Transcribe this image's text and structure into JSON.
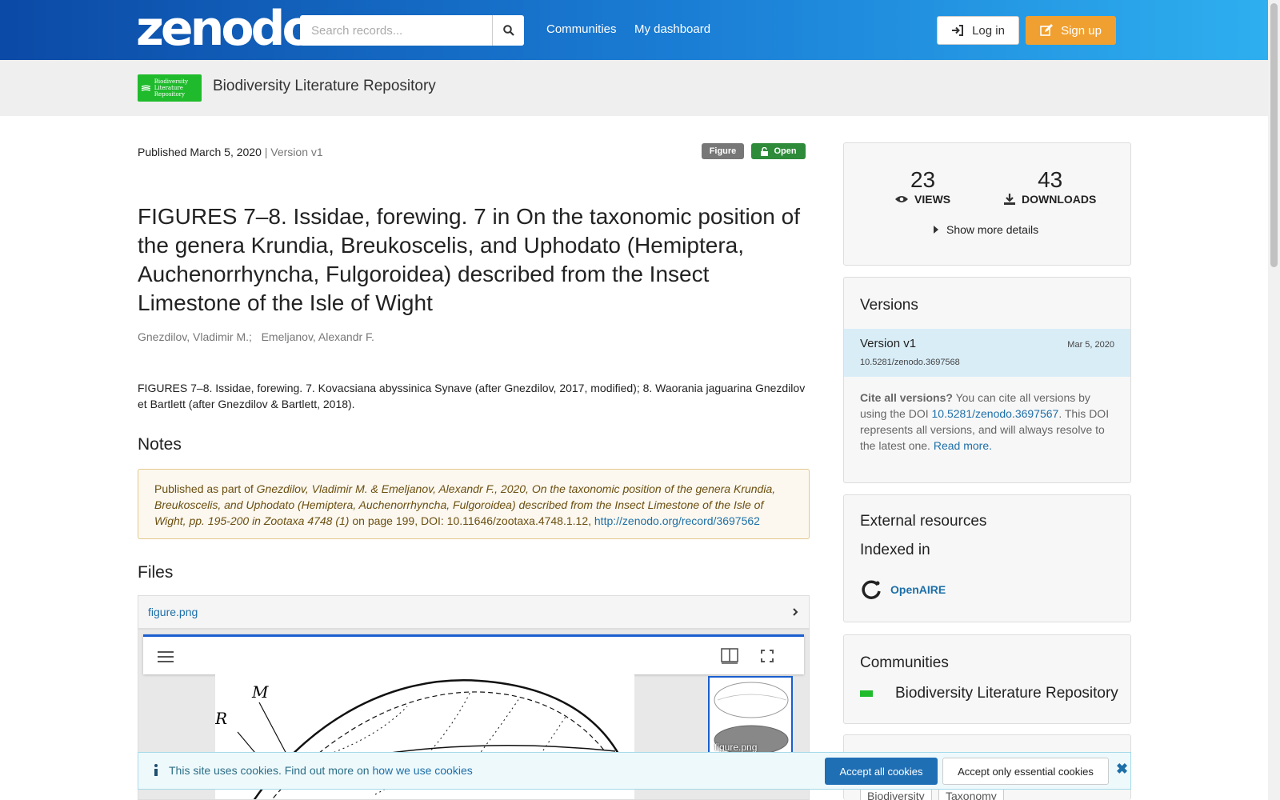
{
  "header": {
    "logo": "zenodo",
    "search_placeholder": "Search records...",
    "nav": [
      "Communities",
      "My dashboard"
    ],
    "login_label": "Log in",
    "signup_label": "Sign up",
    "accent_color": "#f0a030"
  },
  "community_bar": {
    "logo_text": "Biodiversity Literature Repository",
    "title": "Biodiversity Literature Repository"
  },
  "record": {
    "published": "Published March 5, 2020",
    "version": "| Version v1",
    "badge_type": "Figure",
    "badge_access": "Open",
    "title": "FIGURES 7–8. Issidae, forewing. 7 in On the taxonomic position of the genera Krundia, Breukoscelis, and Uphodato (Hemiptera, Auchenorrhyncha, Fulgoroidea) described from the Insect Limestone of the Isle of Wight",
    "authors": [
      "Gnezdilov, Vladimir M.;",
      "Emeljanov, Alexandr F."
    ],
    "description": "FIGURES 7–8. Issidae, forewing. 7. Kovacsiana abyssinica Synave (after Gnezdilov, 2017, modified); 8. Waorania jaguarina Gnezdilov et Bartlett (after Gnezdilov & Bartlett, 2018)."
  },
  "notes": {
    "heading": "Notes",
    "prefix": "Published as part of ",
    "citation": "Gnezdilov, Vladimir M. & Emeljanov, Alexandr F., 2020, On the taxonomic position of the genera Krundia, Breukoscelis, and Uphodato (Hemiptera, Auchenorrhyncha, Fulgoroidea) described from the Insect Limestone of the Isle of Wight, pp. 195-200 in Zootaxa 4748 (1)",
    "suffix": " on page 199, DOI: 10.11646/zootaxa.4748.1.12, ",
    "link": "http://zenodo.org/record/3697562"
  },
  "files": {
    "heading": "Files",
    "filename": "figure.png",
    "thumb_label": "figure.png",
    "figure_labels": [
      "M",
      "R"
    ]
  },
  "stats": {
    "views_count": "23",
    "views_label": "VIEWS",
    "downloads_count": "43",
    "downloads_label": "DOWNLOADS",
    "more_details": "Show more details"
  },
  "versions": {
    "heading": "Versions",
    "items": [
      {
        "name": "Version v1",
        "date": "Mar 5, 2020",
        "doi": "10.5281/zenodo.3697568"
      }
    ],
    "cite_strong": "Cite all versions?",
    "cite_text1": " You can cite all versions by using the DOI ",
    "cite_doi": "10.5281/zenodo.3697567",
    "cite_text2": ". This DOI represents all versions, and will always resolve to the latest one. ",
    "read_more": "Read more."
  },
  "external": {
    "heading": "External resources",
    "subheading": "Indexed in",
    "openaire": "OpenAIRE"
  },
  "communities": {
    "heading": "Communities",
    "item": "Biodiversity Literature Repository"
  },
  "subjects": {
    "tags": [
      "Biodiversity",
      "Taxonomy"
    ]
  },
  "cookie": {
    "text": "This site uses cookies. Find out more on ",
    "link": "how we use cookies",
    "accept_all": "Accept all cookies",
    "accept_essential": "Accept only essential cookies"
  }
}
